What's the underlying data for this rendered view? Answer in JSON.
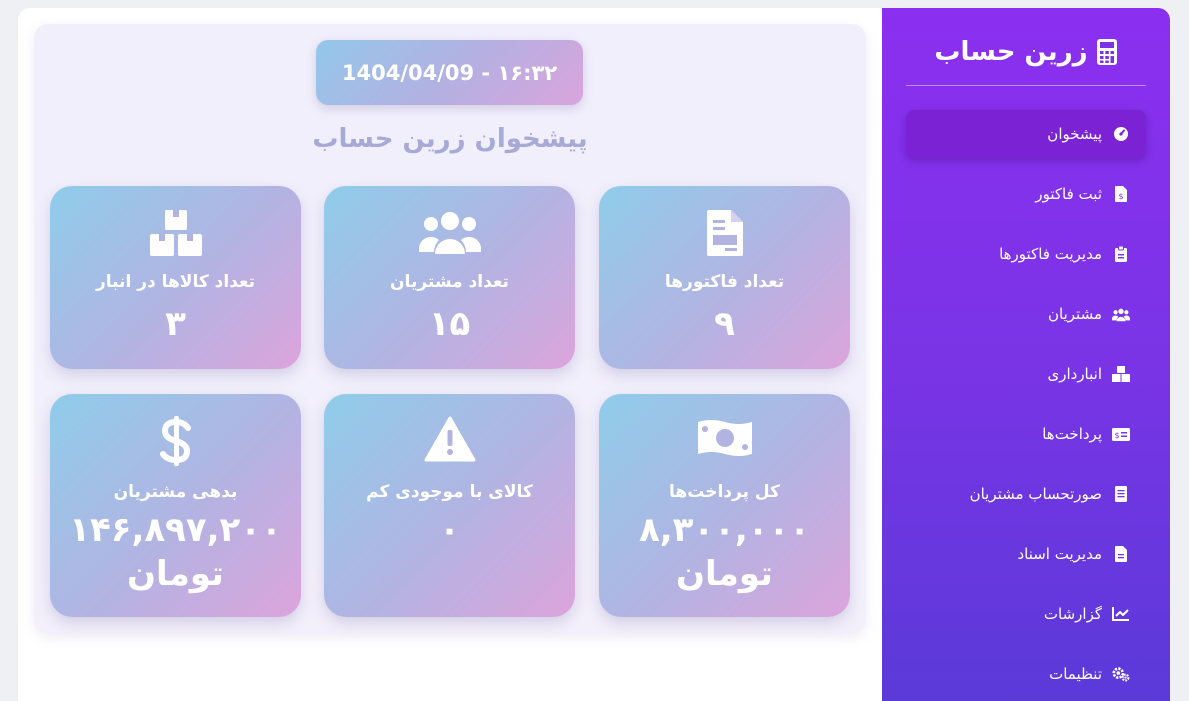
{
  "app": {
    "brand_name": "زرین حساب"
  },
  "header": {
    "datetime": "1404/04/09 - ۱۶:۳۲",
    "page_title": "پیشخوان زرین حساب"
  },
  "stats": {
    "invoices": {
      "label": "تعداد فاکتورها",
      "value": "۹"
    },
    "customers": {
      "label": "تعداد مشتریان",
      "value": "۱۵"
    },
    "products": {
      "label": "تعداد کالاها در انبار",
      "value": "۳"
    },
    "payments": {
      "label": "کل پرداخت‌ها",
      "value": "۸,۳۰۰,۰۰۰",
      "unit": "تومان"
    },
    "low_stock": {
      "label": "کالای با موجودی کم",
      "value": "۰"
    },
    "debt": {
      "label": "بدهی مشتریان",
      "value": "۱۴۶,۸۹۷,۲۰۰",
      "unit": "تومان"
    }
  },
  "sidebar": {
    "items": [
      {
        "label": "پیشخوان",
        "icon": "dashboard-gauge-icon",
        "active": true
      },
      {
        "label": "ثبت فاکتور",
        "icon": "invoice-file-icon"
      },
      {
        "label": "مدیریت فاکتورها",
        "icon": "clipboard-icon"
      },
      {
        "label": "مشتریان",
        "icon": "users-icon"
      },
      {
        "label": "انبارداری",
        "icon": "boxes-icon"
      },
      {
        "label": "پرداخت‌ها",
        "icon": "money-card-icon"
      },
      {
        "label": "صورتحساب مشتریان",
        "icon": "document-icon"
      },
      {
        "label": "مدیریت اسناد",
        "icon": "file-text-icon"
      },
      {
        "label": "گزارشات",
        "icon": "chart-line-icon"
      },
      {
        "label": "تنظیمات",
        "icon": "gears-icon"
      }
    ]
  },
  "colors": {
    "sidebar_top": "#8b2ff0",
    "sidebar_bottom": "#5a3ad8",
    "active_item": "#7b22d4",
    "card_blue": "#8fcdea",
    "card_pink": "#dca4dc",
    "title_text": "#a7a9d6"
  }
}
